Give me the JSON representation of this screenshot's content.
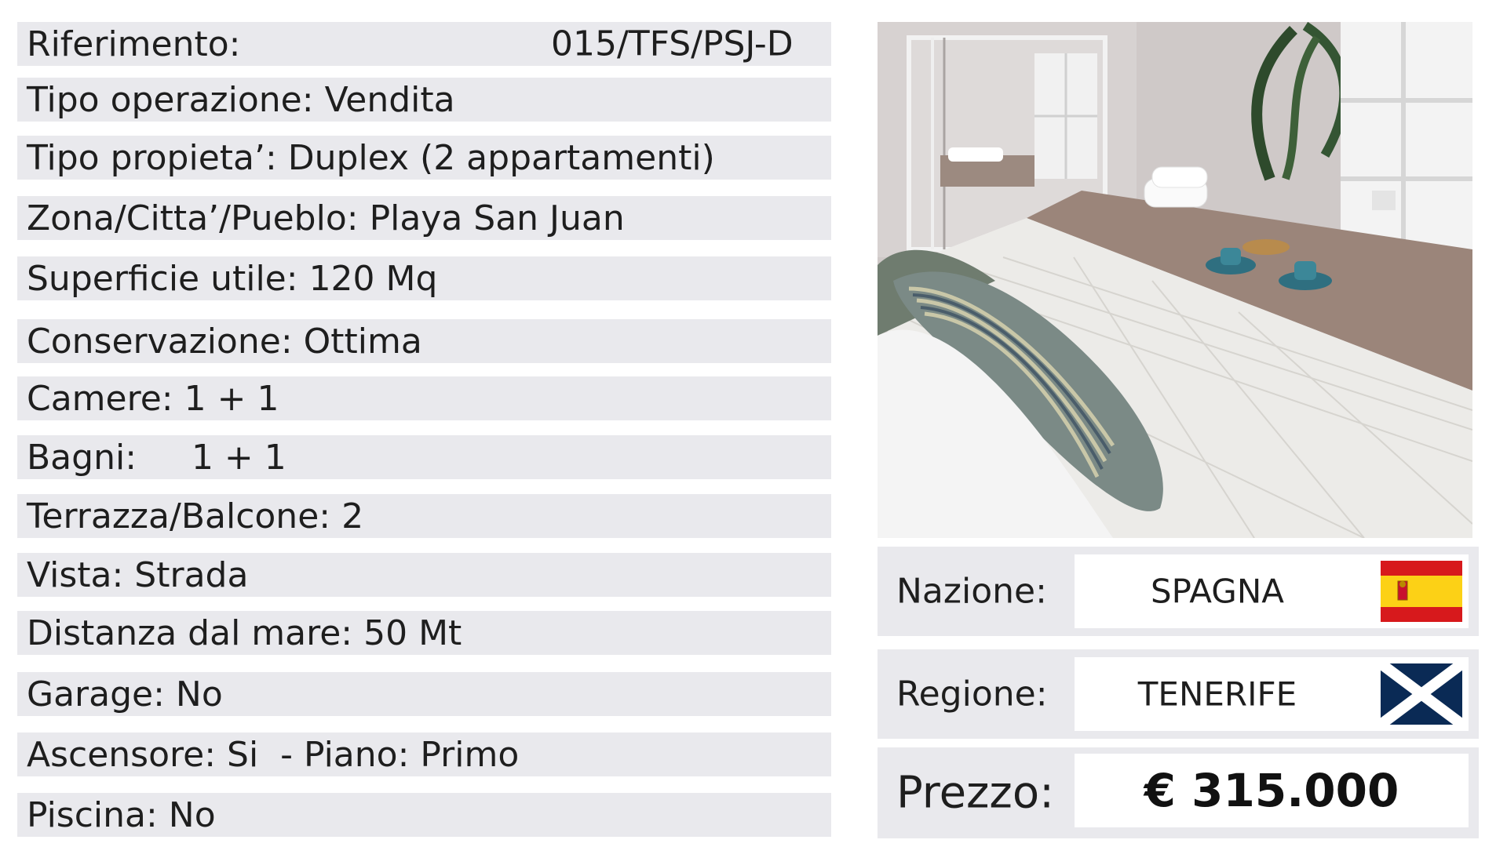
{
  "details": {
    "riferimento_label": "Riferimento:",
    "riferimento_value": "015/TFS/PSJ-D",
    "tipo_operazione": "Tipo operazione: Vendita",
    "tipo_proprieta": "Tipo propieta’: Duplex (2 appartamenti)",
    "zona": "Zona/Citta’/Pueblo: Playa San Juan",
    "superficie": "Superficie utile: 120 Mq",
    "conservazione": "Conservazione: Ottima",
    "camere": "Camere: 1 + 1",
    "bagni": "Bagni:     1 + 1",
    "terrazza": "Terrazza/Balcone: 2",
    "vista": "Vista: Strada",
    "distanza": "Distanza dal mare: 50 Mt",
    "garage": "Garage: No",
    "ascensore": "Ascensore: Si  - Piano: Primo",
    "piscina": "Piscina: No"
  },
  "summary": {
    "nazione_label": "Nazione:",
    "nazione_value": "SPAGNA",
    "nazione_flag": "spain-flag-icon",
    "regione_label": "Regione:",
    "regione_value": "TENERIFE",
    "regione_flag": "tenerife-flag-icon",
    "prezzo_label": "Prezzo:",
    "prezzo_value": "€ 315.000"
  },
  "colors": {
    "row_background": "#e9e9ed",
    "value_background": "#ffffff",
    "spain_red": "#d7191c",
    "spain_yellow": "#fcd116",
    "tenerife_blue": "#0a2a55"
  }
}
